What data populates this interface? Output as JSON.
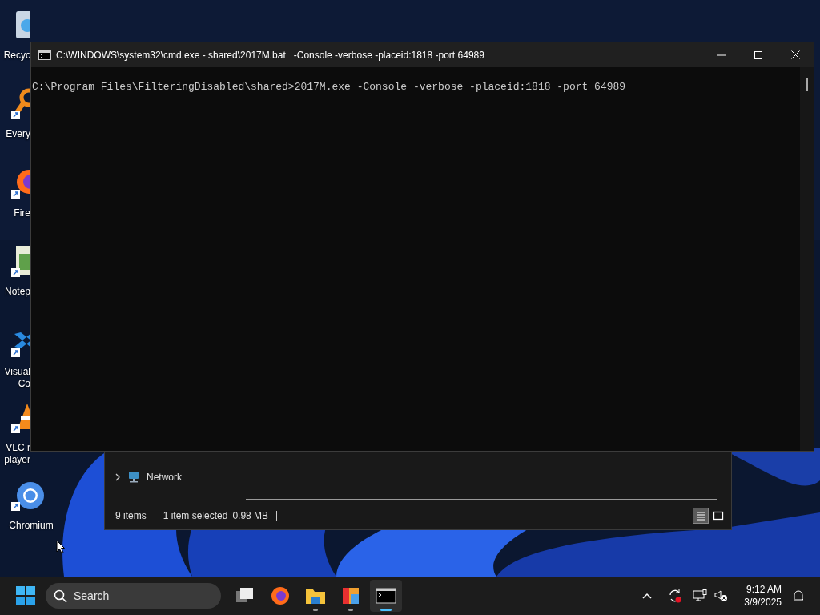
{
  "desktop_icons": [
    {
      "kind": "recycle-bin",
      "label_lines": [
        "Recyc"
      ],
      "shortcut": false
    },
    {
      "kind": "magnifier",
      "label_lines": [
        "Every"
      ],
      "shortcut": true
    },
    {
      "kind": "firefox",
      "label_lines": [
        "Fire"
      ],
      "shortcut": true
    },
    {
      "kind": "notepad",
      "label_lines": [
        "Notep"
      ],
      "shortcut": true
    },
    {
      "kind": "vscode",
      "label_lines": [
        "Visual",
        "Co"
      ],
      "shortcut": true
    },
    {
      "kind": "vlc",
      "label_lines": [
        "VLC r",
        "player"
      ],
      "shortcut": true
    },
    {
      "kind": "chromium",
      "label_lines": [
        "Chromium"
      ],
      "shortcut": true
    }
  ],
  "explorer": {
    "nav_item": "Network",
    "status": [
      "9 items",
      "1 item selected",
      "0.98 MB"
    ],
    "views": [
      {
        "kind": "details",
        "selected": true
      },
      {
        "kind": "tiles",
        "selected": false
      }
    ]
  },
  "console": {
    "title": "C:\\WINDOWS\\system32\\cmd.exe - shared\\2017M.bat   -Console -verbose -placeid:1818 -port 64989",
    "lines": [
      "C:\\Program Files\\FilteringDisabled\\shared>2017M.exe -Console -verbose -placeid:1818 -port 64989"
    ]
  },
  "taskbar": {
    "search_placeholder": "Search",
    "apps": [
      {
        "kind": "task-view",
        "running": false,
        "active": false
      },
      {
        "kind": "firefox",
        "running": false,
        "active": false
      },
      {
        "kind": "folder",
        "running": true,
        "active": false
      },
      {
        "kind": "photos",
        "running": true,
        "active": false
      },
      {
        "kind": "terminal",
        "running": true,
        "active": true
      }
    ],
    "time": "9:12 AM",
    "date": "3/9/2025"
  }
}
